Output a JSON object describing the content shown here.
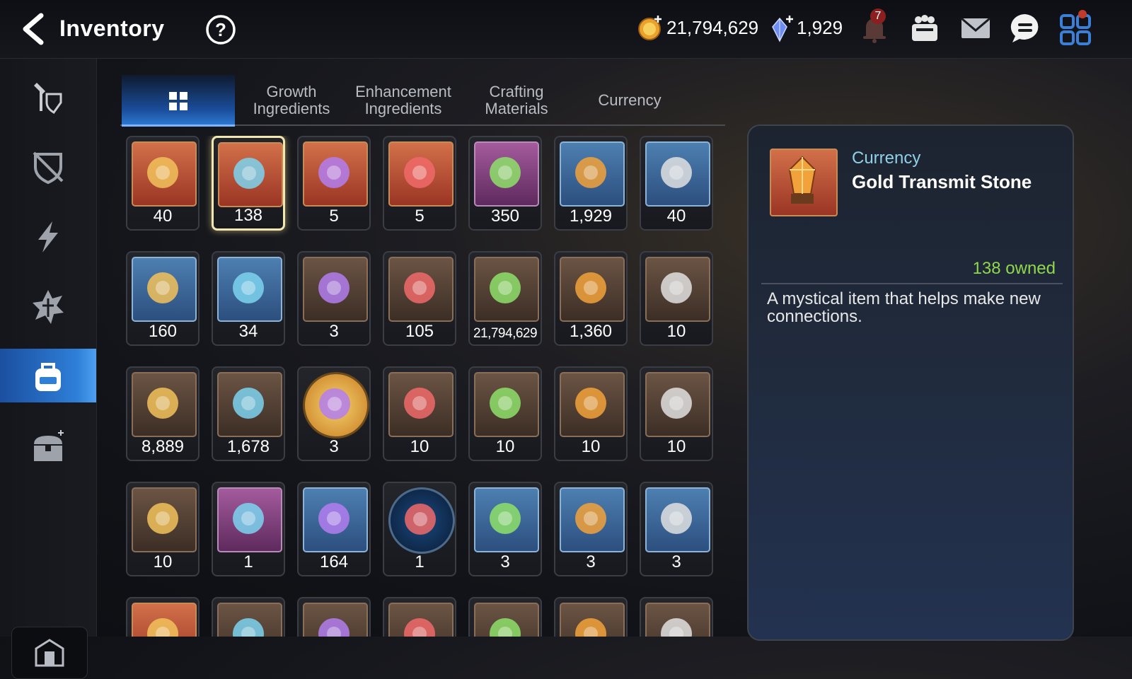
{
  "header": {
    "title": "Inventory",
    "gold_amount": "21,794,629",
    "gem_amount": "1,929",
    "notification_count": "7"
  },
  "tabs": [
    {
      "label": "",
      "icon": "grid-icon",
      "active": true
    },
    {
      "label": "Growth Ingredients"
    },
    {
      "label": "Enhancement Ingredients"
    },
    {
      "label": "Crafting Materials"
    },
    {
      "label": "Currency"
    }
  ],
  "sidebar": {
    "items": [
      {
        "icon": "hero-gear-icon"
      },
      {
        "icon": "shield-unequip-icon"
      },
      {
        "icon": "lightning-icon"
      },
      {
        "icon": "artifact-icon"
      },
      {
        "icon": "backpack-icon",
        "active": true
      },
      {
        "icon": "chest-icon"
      }
    ],
    "bottom_icon": "guild-icon"
  },
  "items": [
    {
      "count": "40",
      "color": "orange",
      "icon": "eye-emblem"
    },
    {
      "count": "138",
      "color": "orange",
      "icon": "gold-transmit-stone",
      "selected": true
    },
    {
      "count": "5",
      "color": "orange",
      "icon": "blue-charm"
    },
    {
      "count": "5",
      "color": "orange",
      "icon": "green-clover-charm"
    },
    {
      "count": "350",
      "color": "purple",
      "icon": "red-flower-ring"
    },
    {
      "count": "1,929",
      "color": "blue",
      "icon": "crystal-gem"
    },
    {
      "count": "40",
      "color": "blue",
      "icon": "teal-crystal"
    },
    {
      "count": "160",
      "color": "blue",
      "icon": "leaf"
    },
    {
      "count": "34",
      "color": "blue",
      "icon": "star-charm"
    },
    {
      "count": "3",
      "color": "brown",
      "icon": "purple-seal"
    },
    {
      "count": "105",
      "color": "brown",
      "icon": "green-heart"
    },
    {
      "count": "21,794,629",
      "color": "brown",
      "icon": "gold-coin"
    },
    {
      "count": "1,360",
      "color": "brown",
      "icon": "fist-emblem"
    },
    {
      "count": "10",
      "color": "brown",
      "icon": "red-banner"
    },
    {
      "count": "8,889",
      "color": "brown",
      "icon": "horse-token"
    },
    {
      "count": "1,678",
      "color": "brown",
      "icon": "red-leaf"
    },
    {
      "count": "3",
      "color": "gold-round",
      "icon": "mascot-coin"
    },
    {
      "count": "10",
      "color": "brown",
      "icon": "purple-orb"
    },
    {
      "count": "10",
      "color": "brown",
      "icon": "red-orb"
    },
    {
      "count": "10",
      "color": "brown",
      "icon": "cyan-orb"
    },
    {
      "count": "10",
      "color": "brown",
      "icon": "yellow-orb"
    },
    {
      "count": "10",
      "color": "brown",
      "icon": "green-orb"
    },
    {
      "count": "1",
      "color": "purple",
      "icon": "fox-tail"
    },
    {
      "count": "164",
      "color": "blue",
      "icon": "ginseng"
    },
    {
      "count": "1",
      "color": "dark-round",
      "icon": "blue-rune-coin"
    },
    {
      "count": "3",
      "color": "blue",
      "icon": "red-gem-box"
    },
    {
      "count": "3",
      "color": "blue",
      "icon": "blue-gem-box"
    },
    {
      "count": "3",
      "color": "blue",
      "icon": "green-gem-box"
    },
    {
      "count": "",
      "color": "orange",
      "icon": "partial-item"
    },
    {
      "count": "",
      "color": "brown",
      "icon": "partial-item"
    },
    {
      "count": "",
      "color": "brown",
      "icon": "partial-item"
    },
    {
      "count": "",
      "color": "brown",
      "icon": "partial-item"
    },
    {
      "count": "",
      "color": "brown",
      "icon": "partial-item"
    },
    {
      "count": "",
      "color": "brown",
      "icon": "partial-item"
    },
    {
      "count": "",
      "color": "brown",
      "icon": "partial-item"
    }
  ],
  "detail": {
    "category": "Currency",
    "name": "Gold Transmit Stone",
    "owned": "138 owned",
    "description": "A mystical item that helps make new connections."
  },
  "colors": {
    "accent_blue": "#2e7fd8",
    "owned_green": "#8fd84a",
    "category_cyan": "#8fd0e8",
    "selected_border": "#f3e7b0"
  }
}
